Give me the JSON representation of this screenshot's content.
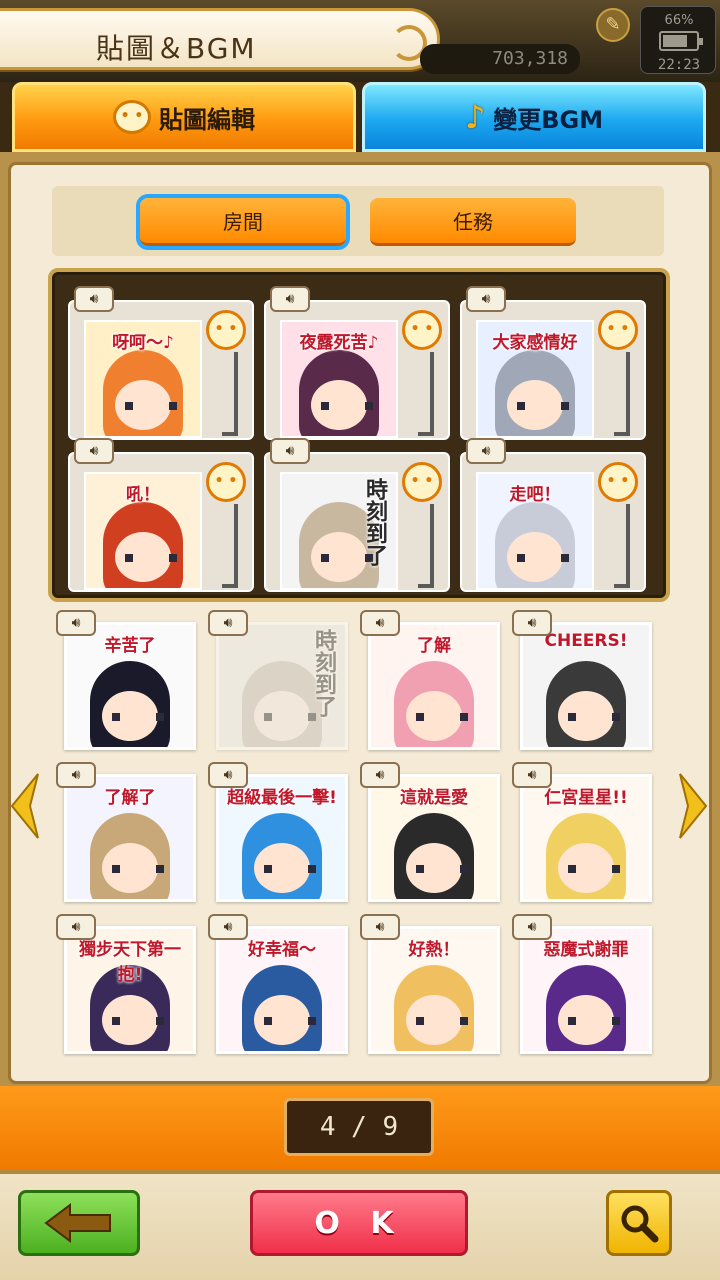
{
  "header": {
    "title": "貼圖＆BGM",
    "currency_value": "703,318",
    "battery_percent": "66%",
    "clock": "22:23"
  },
  "main_tabs": [
    {
      "label": "貼圖編輯",
      "icon": "speech-bubble-icon",
      "active": true
    },
    {
      "label": "變更BGM",
      "icon": "music-note-icon",
      "active": false
    }
  ],
  "sub_tabs": [
    {
      "label": "房間",
      "active": true
    },
    {
      "label": "任務",
      "active": false
    }
  ],
  "selected_stickers": [
    {
      "caption": "呀呵～♪",
      "bg": "#fff0c8",
      "hair": "#f08030"
    },
    {
      "caption": "夜露死苦♪",
      "bg": "#ffe0e8",
      "hair": "#5a2a4a"
    },
    {
      "caption": "大家感情好",
      "bg": "#e8f0ff",
      "hair": "#a0a8b8"
    },
    {
      "caption": "吼！",
      "bg": "#fff0d8",
      "hair": "#d04020"
    },
    {
      "caption": "時刻到了",
      "bg": "#f4f4f4",
      "hair": "#c8b8a0",
      "vertical": true
    },
    {
      "caption": "走吧！",
      "bg": "#f0f4ff",
      "hair": "#c8ccd8"
    }
  ],
  "grid_stickers": [
    {
      "caption": "辛苦了",
      "bg": "#fafafa",
      "hair": "#1a1a2a"
    },
    {
      "caption": "時刻到了",
      "bg": "#e8e8e8",
      "hair": "#c8b8a0",
      "dim": true,
      "vertical": true
    },
    {
      "caption": "了解",
      "bg": "#fff4f0",
      "hair": "#f0a0b0"
    },
    {
      "caption": "CHEERS!",
      "bg": "#f4f4f4",
      "hair": "#3a3a3a"
    },
    {
      "caption": "了解了",
      "bg": "#f4f4ff",
      "hair": "#c8a878"
    },
    {
      "caption": "超級最後一擊!",
      "bg": "#f0f8ff",
      "hair": "#3090e0"
    },
    {
      "caption": "這就是愛",
      "bg": "#fff8e8",
      "hair": "#2a2a2a"
    },
    {
      "caption": "仁宮星星!!",
      "bg": "#fff8f0",
      "hair": "#f0d060"
    },
    {
      "caption": "獨步天下第一抱!",
      "bg": "#fff4e8",
      "hair": "#3a2a5a"
    },
    {
      "caption": "好幸福～",
      "bg": "#fff4f8",
      "hair": "#2a5aa0"
    },
    {
      "caption": "好熱！",
      "bg": "#fff8f0",
      "hair": "#f0c060"
    },
    {
      "caption": "惡魔式謝罪",
      "bg": "#fff4f8",
      "hair": "#5a2a8a"
    }
  ],
  "pagination": {
    "current": "4",
    "total": "9",
    "display": "4 / 9"
  },
  "footer": {
    "ok_label": "O K"
  },
  "colors": {
    "accent_orange": "#ff8a00",
    "accent_blue": "#1ca8f0",
    "ok_red": "#f0304a",
    "back_green": "#4cb020",
    "search_yellow": "#f0b400"
  }
}
